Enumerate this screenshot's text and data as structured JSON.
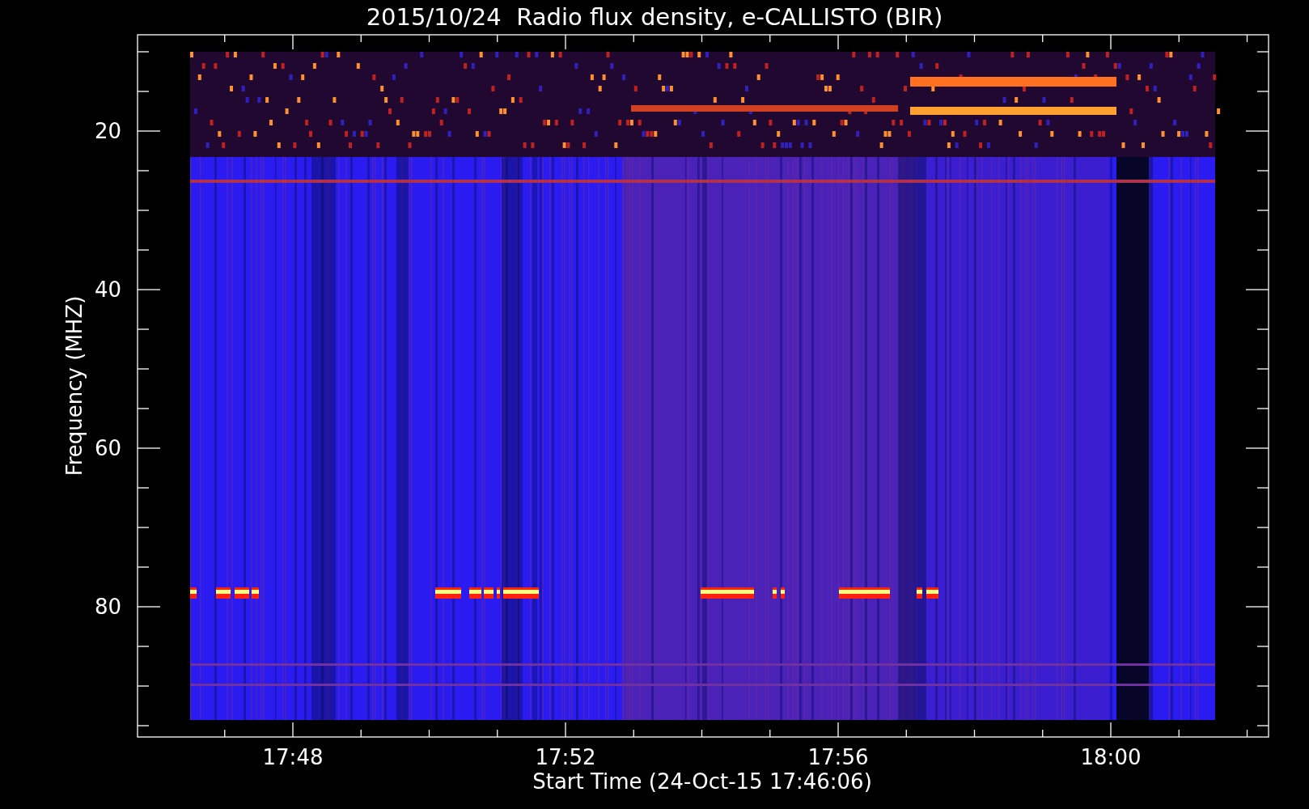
{
  "title": "2015/10/24  Radio flux density, e-CALLISTO (BIR)",
  "plot": {
    "ylabel": "Frequency (MHZ)",
    "xlabel": "Start Time (24-Oct-15 17:46:06)",
    "yticks": [
      {
        "label": "20"
      },
      {
        "label": "40"
      },
      {
        "label": "60"
      },
      {
        "label": "80"
      }
    ],
    "xticks": [
      {
        "label": "17:48"
      },
      {
        "label": "17:52"
      },
      {
        "label": "17:56"
      },
      {
        "label": "18:00"
      }
    ]
  }
}
